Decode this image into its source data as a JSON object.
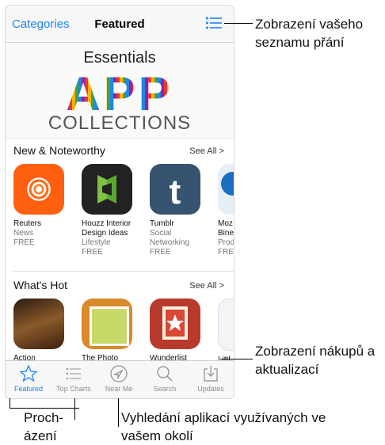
{
  "nav": {
    "categories": "Categories",
    "title": "Featured"
  },
  "banner": {
    "title": "Essentials",
    "app": "APP",
    "subtitle": "COLLECTIONS"
  },
  "sections": [
    {
      "title": "New & Noteworthy",
      "see_all": "See All >",
      "apps": [
        {
          "name": "Reuters",
          "category": "News",
          "price": "FREE"
        },
        {
          "name": "Houzz Interior Design Ideas",
          "category": "Lifestyle",
          "price": "FREE"
        },
        {
          "name": "Tumblr",
          "category": "Social Networking",
          "price": "FREE"
        },
        {
          "name": "Moz Bine",
          "category": "Prod",
          "price": "FRE"
        }
      ]
    },
    {
      "title": "What's Hot",
      "see_all": "See All >",
      "apps": [
        {
          "name": "Action"
        },
        {
          "name": "The Photo"
        },
        {
          "name": "Wunderlist"
        },
        {
          "name": "Littl"
        }
      ]
    }
  ],
  "tabs": [
    "Featured",
    "Top Charts",
    "Near Me",
    "Search",
    "Updates"
  ],
  "callouts": {
    "wishlist": "Zobrazení vašeho seznamu přání",
    "purchases": "Zobrazení nákupů a aktualizací",
    "browse": "Proch-ázení",
    "nearby": "Vyhledání aplikací využívaných ve vašem okolí"
  },
  "colors": {
    "accent": "#1a82fb"
  }
}
